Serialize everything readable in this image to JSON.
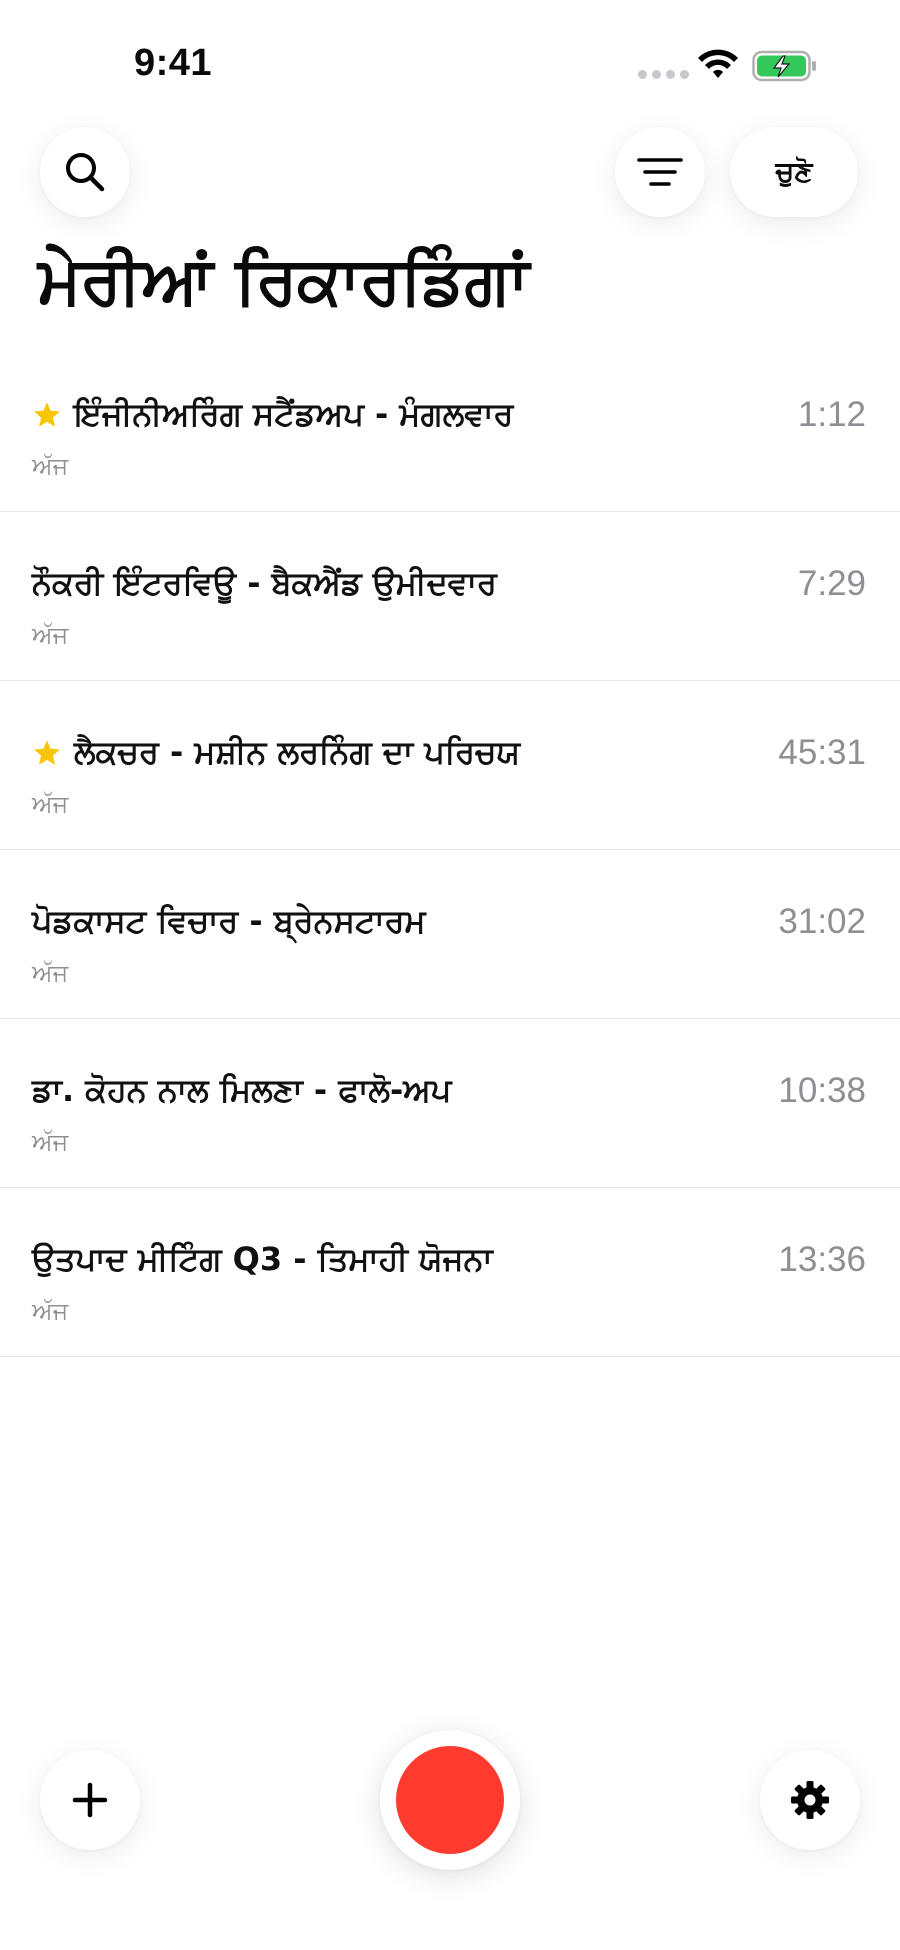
{
  "status_bar": {
    "time": "9:41",
    "icons": [
      "signal-dots-icon",
      "wifi-icon",
      "battery-charging-icon"
    ],
    "battery_color": "#34c759"
  },
  "toolbar": {
    "search_icon": "search-icon",
    "filter_icon": "filter-lines-icon",
    "select_label": "ਚੁਣੋ"
  },
  "page": {
    "title": "ਮੇਰੀਆਂ ਰਿਕਾਰਡਿੰਗਾਂ"
  },
  "recordings": [
    {
      "title": "ਇੰਜੀਨੀਅਰਿੰਗ ਸਟੈਂਡਅਪ - ਮੰਗਲਵਾਰ",
      "date": "ਅੱਜ",
      "duration": "1:12",
      "starred": true
    },
    {
      "title": "ਨੌਕਰੀ ਇੰਟਰਵਿਊ - ਬੈਕਐਂਡ ਉਮੀਦਵਾਰ",
      "date": "ਅੱਜ",
      "duration": "7:29",
      "starred": false
    },
    {
      "title": "ਲੈਕਚਰ - ਮਸ਼ੀਨ ਲਰਨਿੰਗ ਦਾ ਪਰਿਚਯ",
      "date": "ਅੱਜ",
      "duration": "45:31",
      "starred": true
    },
    {
      "title": "ਪੋਡਕਾਸਟ ਵਿਚਾਰ - ਬ੍ਰੇਨਸਟਾਰਮ",
      "date": "ਅੱਜ",
      "duration": "31:02",
      "starred": false
    },
    {
      "title": "ਡਾ. ਕੋਹਨ ਨਾਲ ਮਿਲਣਾ - ਫਾਲੋ-ਅਪ",
      "date": "ਅੱਜ",
      "duration": "10:38",
      "starred": false
    },
    {
      "title": "ਉਤਪਾਦ ਮੀਟਿੰਗ Q3 - ਤਿਮਾਹੀ ਯੋਜਨਾ",
      "date": "ਅੱਜ",
      "duration": "13:36",
      "starred": false
    }
  ],
  "bottom_bar": {
    "add_icon": "plus-icon",
    "record_icon": "record-icon",
    "settings_icon": "gear-icon",
    "record_color": "#ff3b30"
  },
  "colors": {
    "star": "#f7c600",
    "secondary_text": "#8e8e93"
  }
}
